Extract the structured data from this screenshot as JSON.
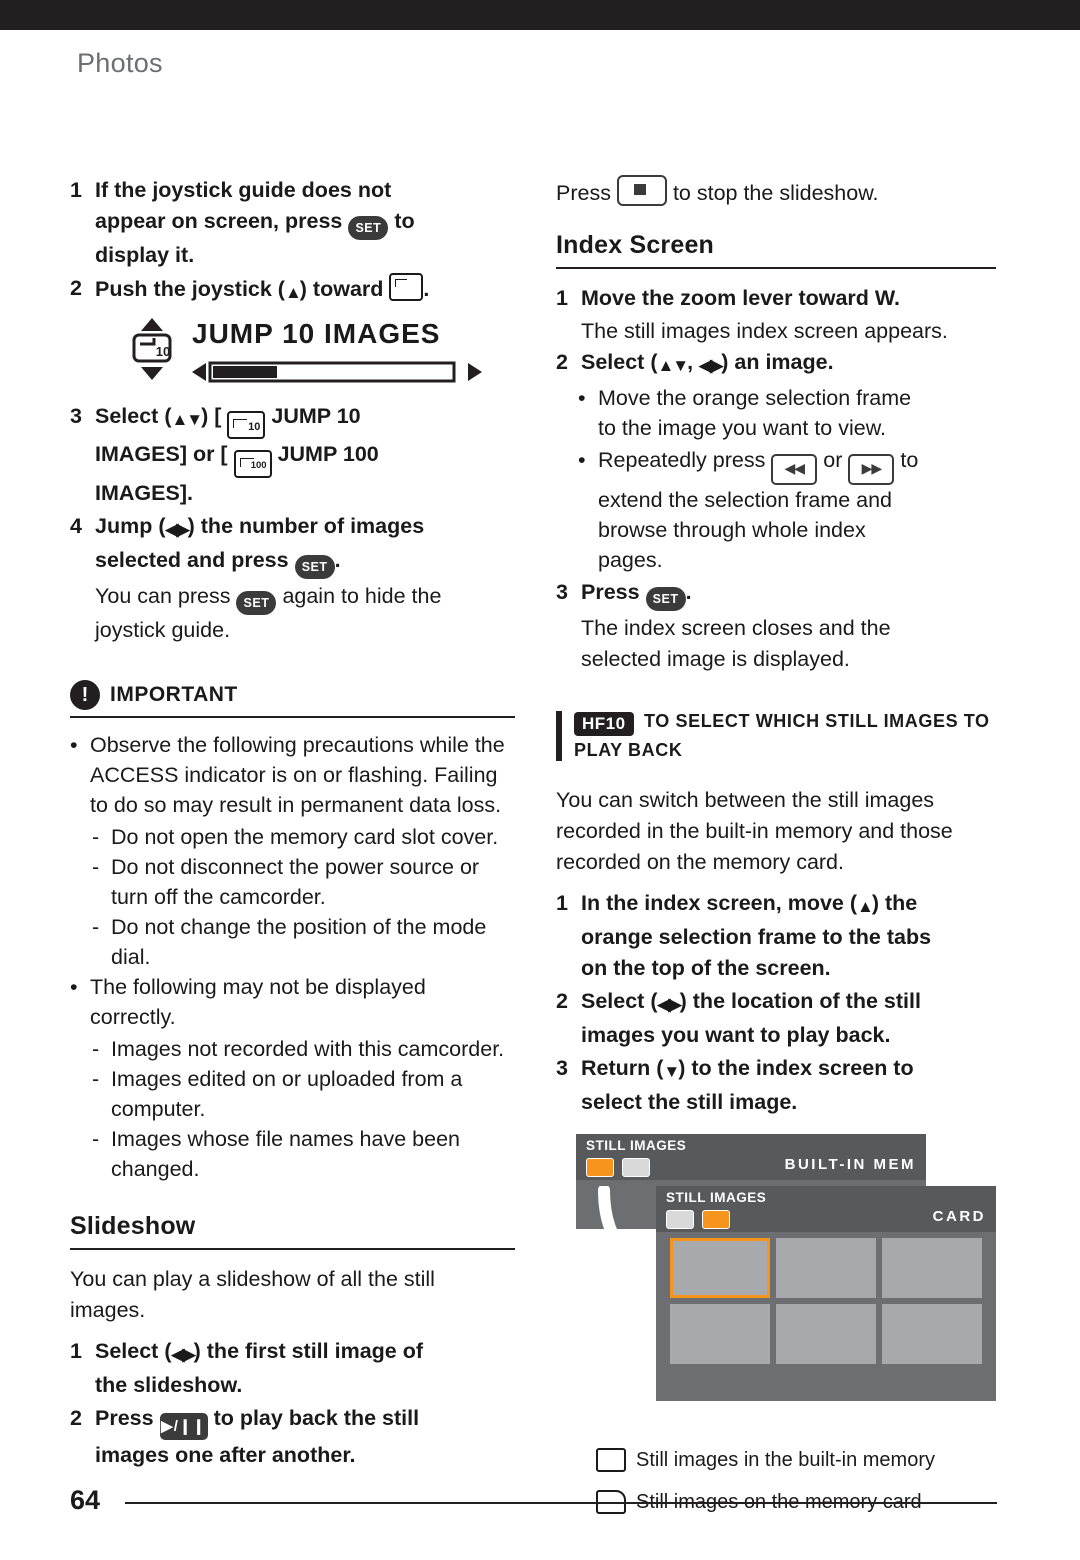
{
  "chapter": "Photos",
  "page_number": "64",
  "left": {
    "steps": [
      {
        "n": "1",
        "parts": [
          "If the joystick guide does not appear on screen, press ",
          "SET",
          " to display it."
        ]
      },
      {
        "n": "2",
        "parts": [
          "Push the joystick (",
          "▲",
          ") toward ",
          "jump-icon",
          "."
        ]
      }
    ],
    "step1_a": "If the joystick guide does not",
    "step1_b": "appear on screen, press",
    "step1_c": "to",
    "step1_d": "display it.",
    "step2_a": "Push the joystick (",
    "step2_b": ") toward",
    "jump_display": {
      "label": "JUMP  10  IMAGES",
      "badge": "10"
    },
    "step3_a": "Select (",
    "step3_b": ") [",
    "step3_c": "JUMP 10",
    "step3_d": "IMAGES] or [",
    "step3_e": "JUMP 100",
    "step3_f": "IMAGES].",
    "step4_a": "Jump (",
    "step4_b": ") the number of images",
    "step4_c": "selected and press",
    "step4_d": ".",
    "step4_note_a": "You can press",
    "step4_note_b": "again to hide the",
    "step4_note_c": "joystick guide.",
    "important": {
      "title": "IMPORTANT",
      "items": [
        {
          "type": "bullet",
          "text": "Observe the following precautions while the ACCESS indicator is on or flashing. Failing to do so may result in permanent data loss."
        },
        {
          "type": "dash",
          "text": "Do not open the memory card slot cover."
        },
        {
          "type": "dash",
          "text": "Do not disconnect the power source or turn off the camcorder."
        },
        {
          "type": "dash",
          "text": "Do not change the position of the mode dial."
        },
        {
          "type": "bullet",
          "text": "The following may not be displayed correctly."
        },
        {
          "type": "dash",
          "text": "Images not recorded with this camcorder."
        },
        {
          "type": "dash",
          "text": "Images edited on or uploaded from a computer."
        },
        {
          "type": "dash",
          "text": "Images whose file names have been changed."
        }
      ]
    },
    "slideshow": {
      "heading": "Slideshow",
      "intro": "You can play a slideshow of all the still images.",
      "step1_a": "Select (",
      "step1_b": ") the first still image of",
      "step1_c": "the slideshow.",
      "step2_a": "Press",
      "step2_b": "to play back the still",
      "step2_c": "images one after another."
    }
  },
  "right": {
    "stop_line_a": "Press",
    "stop_line_b": "to stop the slideshow.",
    "index": {
      "heading": "Index Screen",
      "step1": "Move the zoom lever toward W.",
      "step1_note": "The still images index screen appears.",
      "step2_a": "Select (",
      "step2_b": ",",
      "step2_c": ") an image.",
      "bullet1_a": "Move the orange selection frame",
      "bullet1_b": "to the image you want to view.",
      "bullet2_a": "Repeatedly press",
      "bullet2_b": "or",
      "bullet2_c": "to",
      "bullet2_d": "extend the selection frame and",
      "bullet2_e": "browse through whole index",
      "bullet2_f": "pages.",
      "step3_a": "Press",
      "step3_b": ".",
      "step3_note_a": "The index screen closes and the",
      "step3_note_b": "selected image is displayed."
    },
    "hf10": {
      "tag": "HF10",
      "caption_line1": "TO SELECT WHICH STILL IMAGES TO",
      "caption_line2": "PLAY BACK",
      "intro": "You can switch between the still images recorded in the built-in memory and those recorded on the memory card.",
      "step1": "In the index screen, move (▲) the orange selection frame to the tabs on the top of the screen.",
      "step1_a": "In the index screen, move (",
      "step1_b": ") the",
      "step1_c": "orange selection frame to the tabs",
      "step1_d": "on the top of the screen.",
      "step2_a": "Select (",
      "step2_b": ") the location of the still",
      "step2_c": "images you want to play back.",
      "step3_a": "Return (",
      "step3_b": ") to the index screen to",
      "step3_c": "select the still image."
    },
    "screens": {
      "back": {
        "title": "STILL IMAGES",
        "location": "BUILT-IN MEM"
      },
      "front": {
        "title": "STILL IMAGES",
        "location": "CARD"
      }
    },
    "legend": [
      {
        "icon": "built-in-memory-icon",
        "text": "Still images in the built-in memory"
      },
      {
        "icon": "memory-card-icon",
        "text": "Still images on the memory card"
      }
    ]
  },
  "colors": {
    "accent_orange": "#f7941d",
    "dark": "#231f20",
    "chapter_gray": "#6d6e71"
  }
}
